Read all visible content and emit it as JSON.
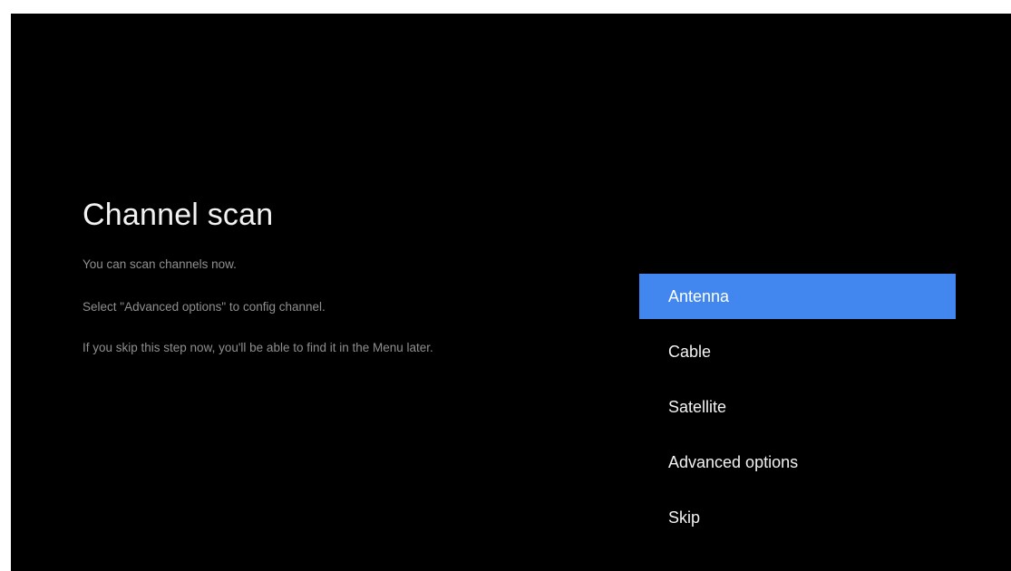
{
  "screen": {
    "title": "Channel scan",
    "description": [
      "You can scan channels now.",
      "Select \"Advanced options\" to config channel.",
      "If you skip this step now, you'll be able to find it in the Menu later."
    ]
  },
  "menu": {
    "items": [
      {
        "label": "Antenna",
        "selected": true
      },
      {
        "label": "Cable",
        "selected": false
      },
      {
        "label": "Satellite",
        "selected": false
      },
      {
        "label": "Advanced options",
        "selected": false
      },
      {
        "label": "Skip",
        "selected": false
      }
    ],
    "highlight_color": "#4287f0"
  },
  "colors": {
    "background": "#000000",
    "title_text": "#f2f2f2",
    "description_text": "#8f8f8f"
  }
}
